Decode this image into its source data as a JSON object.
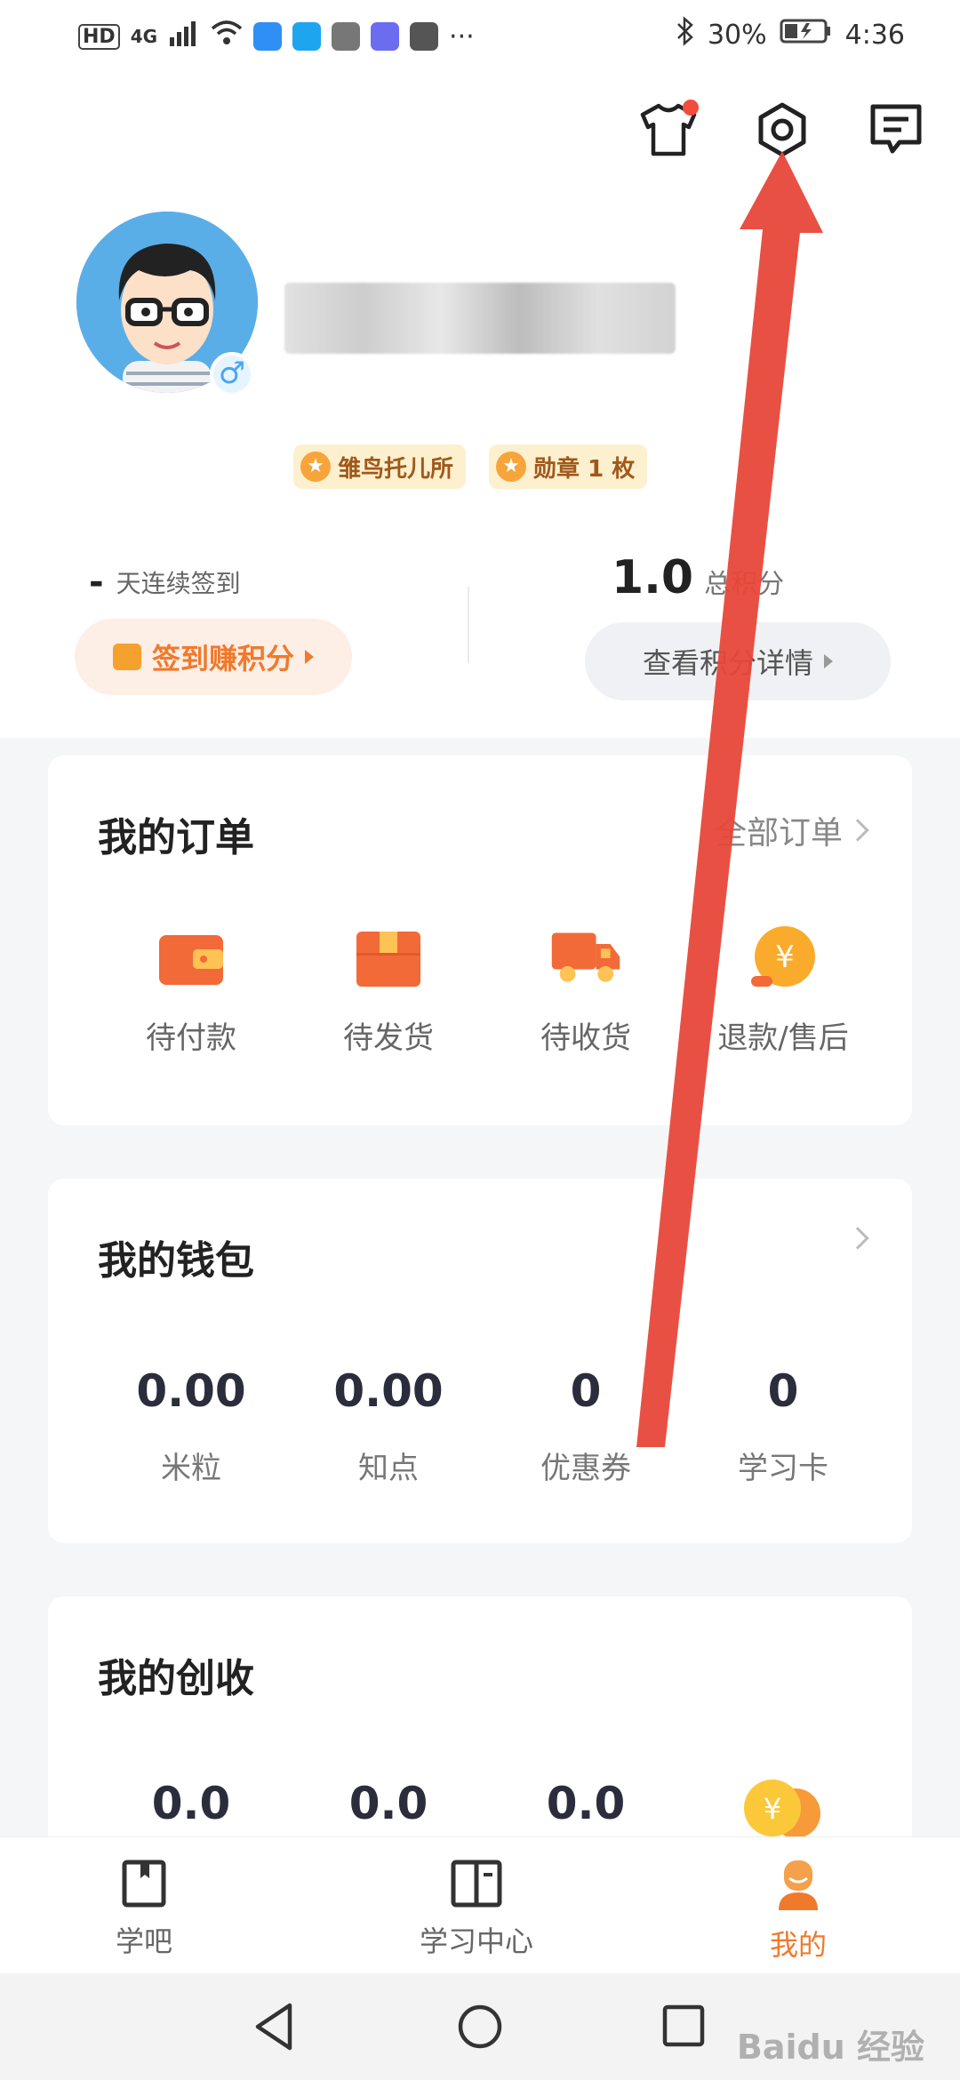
{
  "status_bar": {
    "left_labels": [
      "HD",
      "4G"
    ],
    "overflow": "···",
    "battery": "30%",
    "time": "4:36"
  },
  "header": {
    "icons": [
      "tshirt-icon",
      "settings-icon",
      "message-icon"
    ]
  },
  "profile": {
    "gender_symbol": "♂",
    "badges": [
      {
        "icon": "star",
        "label": "雏鸟托儿所"
      },
      {
        "icon": "medal",
        "label": "勋章 1 枚"
      }
    ]
  },
  "checkin": {
    "streak_value": "-",
    "streak_label": "天连续签到",
    "button_label": "签到赚积分"
  },
  "points": {
    "value": "1.0",
    "label": "总积分",
    "button_label": "查看积分详情"
  },
  "orders": {
    "title": "我的订单",
    "more_label": "全部订单",
    "items": [
      {
        "icon": "wallet-icon",
        "label": "待付款"
      },
      {
        "icon": "package-icon",
        "label": "待发货"
      },
      {
        "icon": "truck-icon",
        "label": "待收货"
      },
      {
        "icon": "refund-icon",
        "label": "退款/售后"
      }
    ]
  },
  "wallet": {
    "title": "我的钱包",
    "items": [
      {
        "value": "0.00",
        "label": "米粒"
      },
      {
        "value": "0.00",
        "label": "知点"
      },
      {
        "value": "0",
        "label": "优惠券"
      },
      {
        "value": "0",
        "label": "学习卡"
      }
    ]
  },
  "income": {
    "title": "我的创收",
    "values": [
      "0.0",
      "0.0",
      "0.0"
    ],
    "coin_symbol": "¥"
  },
  "bottom_nav": {
    "items": [
      {
        "label": "学吧",
        "active": false
      },
      {
        "label": "学习中心",
        "active": false
      },
      {
        "label": "我的",
        "active": true
      }
    ]
  },
  "colors": {
    "accent": "#f07a2c",
    "annotation_arrow": "#e8473a"
  },
  "watermark": "Baidu 经验"
}
